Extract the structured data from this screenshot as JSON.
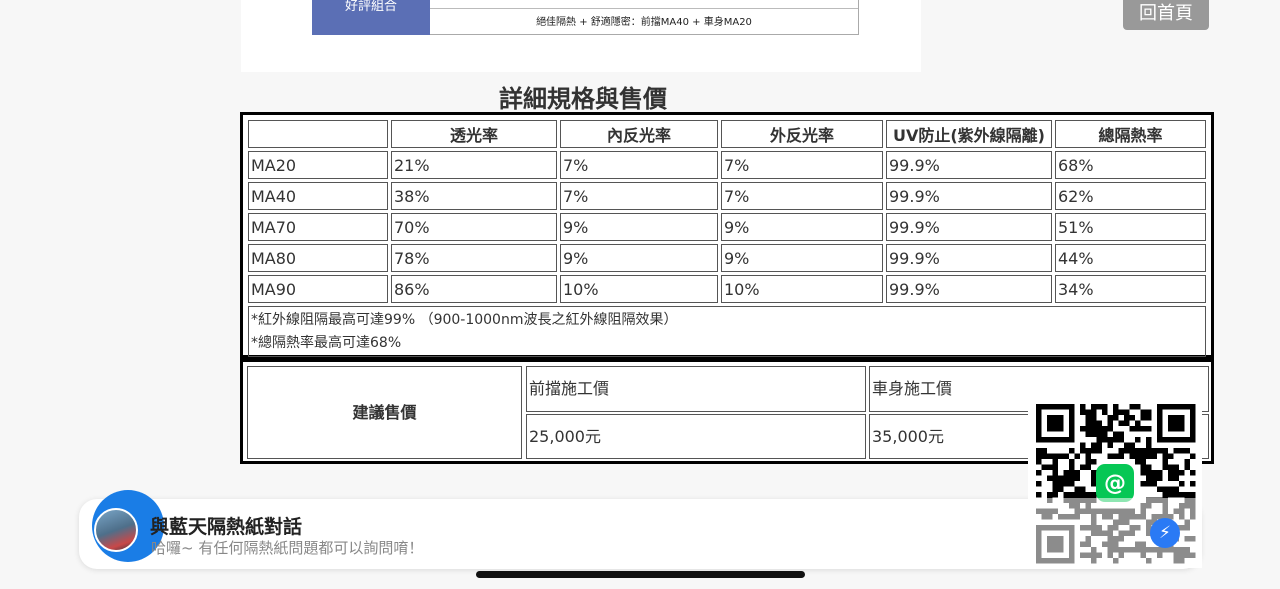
{
  "top_image": {
    "blue_label": "好評組合",
    "caption": "絕佳隔熱 + 舒適隱密：前擋MA40 + 車身MA20"
  },
  "home_button": "回首頁",
  "section_title": "詳細規格與售價",
  "spec_table": {
    "headers": [
      "",
      "透光率",
      "內反光率",
      "外反光率",
      "UV防止(紫外線隔離)",
      "總隔熱率"
    ],
    "rows": [
      [
        "MA20",
        "21%",
        "7%",
        "7%",
        "99.9%",
        "68%"
      ],
      [
        "MA40",
        "38%",
        "7%",
        "7%",
        "99.9%",
        "62%"
      ],
      [
        "MA70",
        "70%",
        "9%",
        "9%",
        "99.9%",
        "51%"
      ],
      [
        "MA80",
        "78%",
        "9%",
        "9%",
        "99.9%",
        "44%"
      ],
      [
        "MA90",
        "86%",
        "10%",
        "10%",
        "99.9%",
        "34%"
      ]
    ],
    "notes": [
      "*紅外線阻隔最高可達99% （900-1000nm波長之紅外線阻隔效果）",
      "*總隔熱率最高可達68%"
    ]
  },
  "price_table": {
    "label": "建議售價",
    "columns": [
      "前擋施工價",
      "車身施工價"
    ],
    "values": [
      "25,000元",
      "35,000元"
    ]
  },
  "chat_widget": {
    "title": "與藍天隔熱紙對話",
    "subtitle": "哈囉~ 有任何隔熱紙問題都可以詢問唷！"
  },
  "icons": {
    "qr": "qr-code-icon",
    "line": "line-at-icon",
    "messenger": "messenger-icon"
  },
  "colors": {
    "blue_label": "#5b6fb5",
    "home_button": "#999999",
    "chat_ring": "#1a7de6",
    "line_green": "#06c755",
    "messenger_blue": "#2a7af5"
  }
}
